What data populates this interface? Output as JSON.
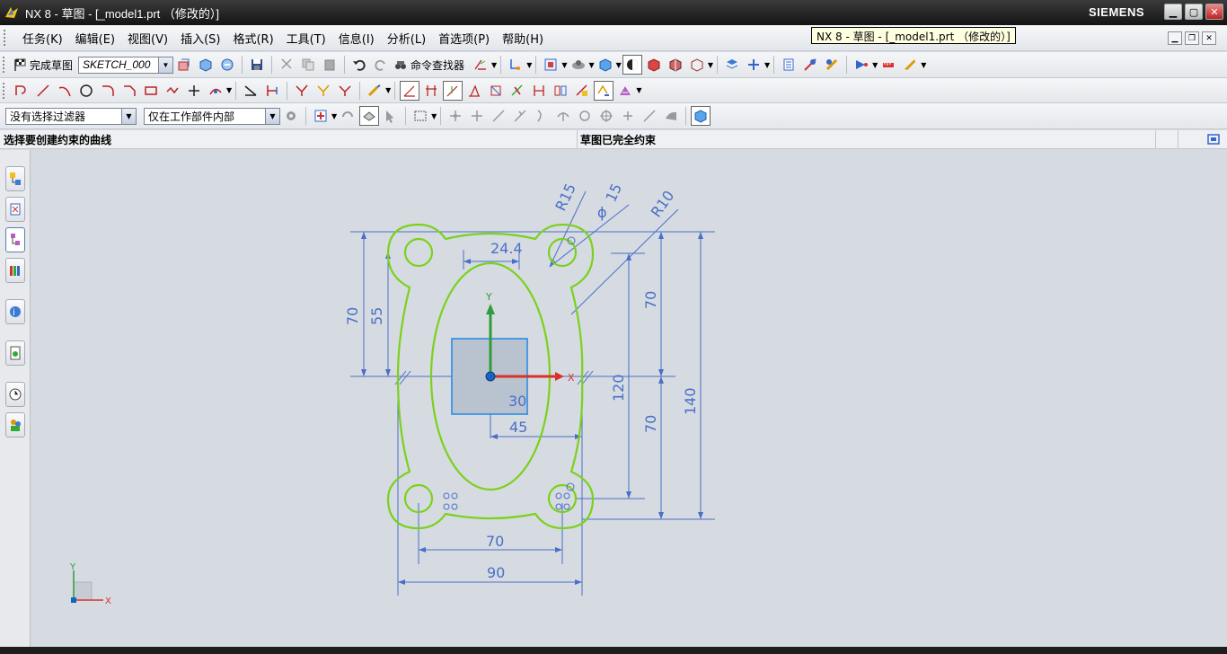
{
  "window": {
    "title": "NX 8 - 草图 - [_model1.prt （修改的）]",
    "brand": "SIEMENS",
    "tooltip": "NX 8 - 草图 - [_model1.prt （修改的）]"
  },
  "menu": [
    "任务(K)",
    "编辑(E)",
    "视图(V)",
    "插入(S)",
    "格式(R)",
    "工具(T)",
    "信息(I)",
    "分析(L)",
    "首选项(P)",
    "帮助(H)"
  ],
  "toolbar": {
    "finish_sketch_label": "完成草图",
    "sketch_name": "SKETCH_000",
    "command_finder_label": "命令查找器"
  },
  "selection": {
    "filter": "没有选择过滤器",
    "scope": "仅在工作部件内部"
  },
  "status": {
    "prompt": "选择要创建约束的曲线",
    "message": "草图已完全约束"
  },
  "sketch": {
    "dimensions": {
      "r15": "R15",
      "phi15": "15",
      "r10": "R10",
      "d24": "24.4",
      "v70_left": "70",
      "v55": "55",
      "v70_right_top": "70",
      "v120": "120",
      "v140": "140",
      "v70_right_bottom": "70",
      "h30": "30",
      "h45": "45",
      "h70": "70",
      "h90": "90"
    },
    "axes": {
      "x": "X",
      "y": "Y"
    }
  },
  "colors": {
    "curve": "#7bd11c",
    "dimension": "#4a6fc7",
    "x_axis": "#d9302a",
    "y_axis": "#2e9c3a",
    "datum": "#1565c0",
    "background": "#d6dbe2"
  }
}
